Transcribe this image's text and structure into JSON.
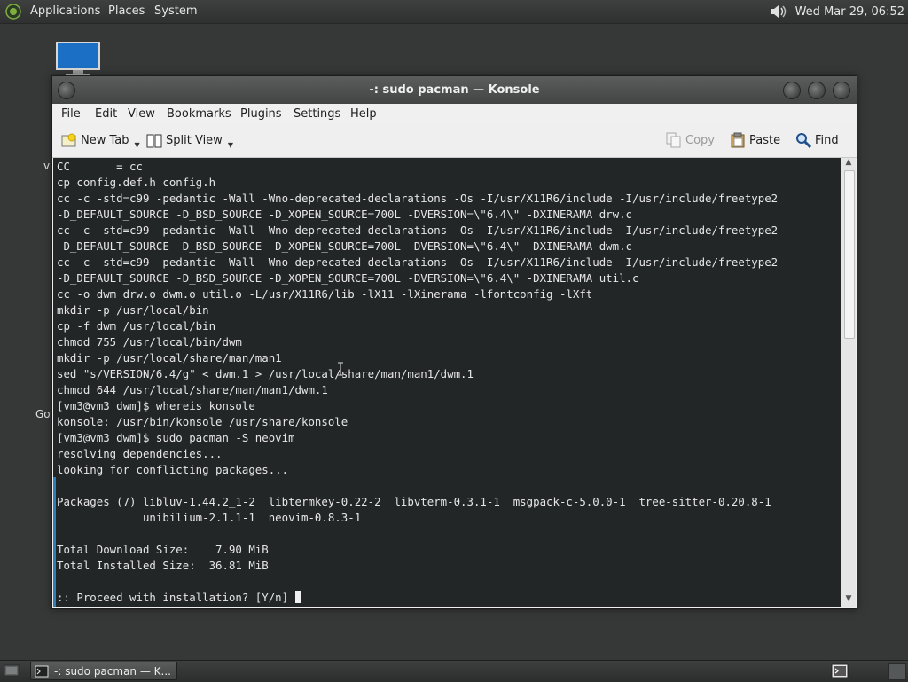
{
  "top_panel": {
    "menus": [
      "Applications",
      "Places",
      "System"
    ],
    "clock": "Wed Mar 29, 06:52",
    "icons": [
      "distro-logo-icon",
      "volume-icon"
    ]
  },
  "desktop": {
    "fragments": [
      "vi",
      "Go"
    ]
  },
  "window": {
    "title": "-: sudo pacman — Konsole",
    "menu": [
      "File",
      "Edit",
      "View",
      "Bookmarks",
      "Plugins",
      "Settings",
      "Help"
    ],
    "toolbar": {
      "new_tab": "New Tab",
      "split_view": "Split View",
      "copy": "Copy",
      "paste": "Paste",
      "find": "Find"
    }
  },
  "terminal": {
    "lines": [
      "CC       = cc",
      "cp config.def.h config.h",
      "cc -c -std=c99 -pedantic -Wall -Wno-deprecated-declarations -Os -I/usr/X11R6/include -I/usr/include/freetype2",
      "-D_DEFAULT_SOURCE -D_BSD_SOURCE -D_XOPEN_SOURCE=700L -DVERSION=\\\"6.4\\\" -DXINERAMA drw.c",
      "cc -c -std=c99 -pedantic -Wall -Wno-deprecated-declarations -Os -I/usr/X11R6/include -I/usr/include/freetype2",
      "-D_DEFAULT_SOURCE -D_BSD_SOURCE -D_XOPEN_SOURCE=700L -DVERSION=\\\"6.4\\\" -DXINERAMA dwm.c",
      "cc -c -std=c99 -pedantic -Wall -Wno-deprecated-declarations -Os -I/usr/X11R6/include -I/usr/include/freetype2",
      "-D_DEFAULT_SOURCE -D_BSD_SOURCE -D_XOPEN_SOURCE=700L -DVERSION=\\\"6.4\\\" -DXINERAMA util.c",
      "cc -o dwm drw.o dwm.o util.o -L/usr/X11R6/lib -lX11 -lXinerama -lfontconfig -lXft",
      "mkdir -p /usr/local/bin",
      "cp -f dwm /usr/local/bin",
      "chmod 755 /usr/local/bin/dwm",
      "mkdir -p /usr/local/share/man/man1",
      "sed \"s/VERSION/6.4/g\" < dwm.1 > /usr/local/share/man/man1/dwm.1",
      "chmod 644 /usr/local/share/man/man1/dwm.1",
      "[vm3@vm3 dwm]$ whereis konsole",
      "konsole: /usr/bin/konsole /usr/share/konsole",
      "[vm3@vm3 dwm]$ sudo pacman -S neovim",
      "resolving dependencies...",
      "looking for conflicting packages...",
      "",
      "Packages (7) libluv-1.44.2_1-2  libtermkey-0.22-2  libvterm-0.3.1-1  msgpack-c-5.0.0-1  tree-sitter-0.20.8-1",
      "             unibilium-2.1.1-1  neovim-0.8.3-1",
      "",
      "Total Download Size:    7.90 MiB",
      "Total Installed Size:  36.81 MiB",
      "",
      ":: Proceed with installation? [Y/n] "
    ]
  },
  "bottom_panel": {
    "task_label": "-: sudo pacman — K..."
  },
  "colors": {
    "terminal_bg": "#232627",
    "terminal_fg": "#e6e6e6",
    "marker": "#2d7db8",
    "panel": "#363838"
  }
}
